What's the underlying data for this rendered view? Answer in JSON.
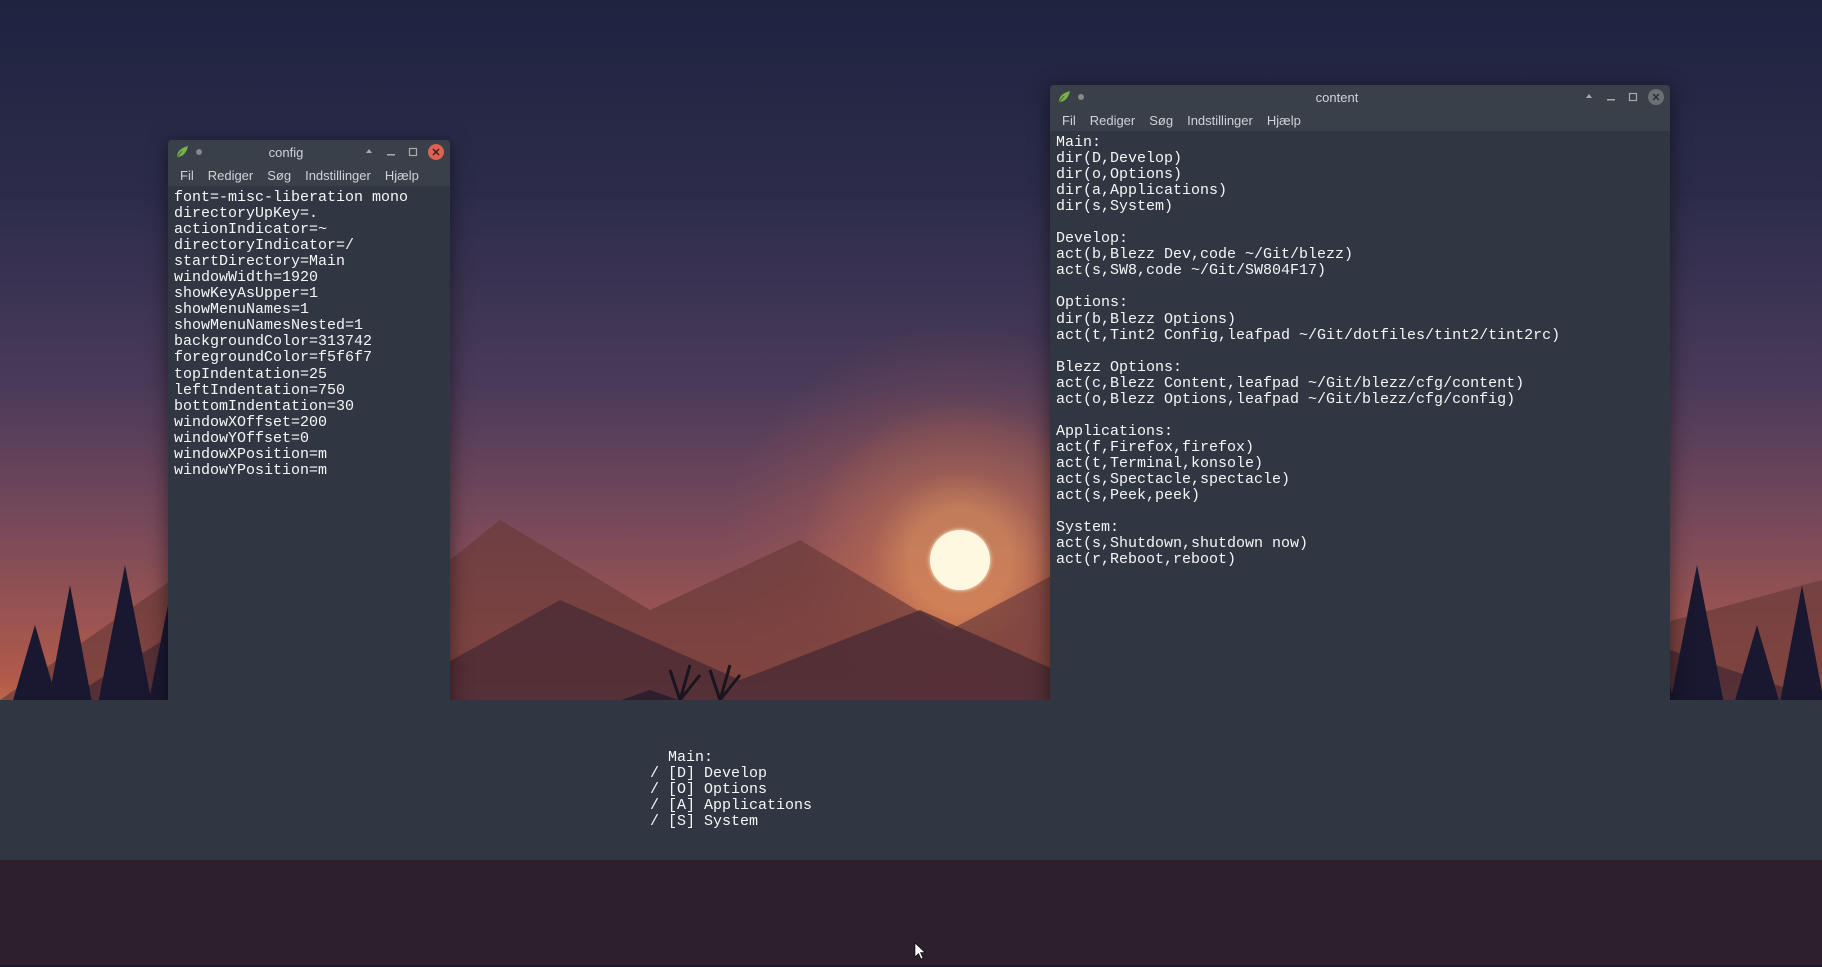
{
  "menubar": {
    "fil": "Fil",
    "rediger": "Rediger",
    "sog": "Søg",
    "indstillinger": "Indstillinger",
    "hjaelp": "Hjælp"
  },
  "window_config": {
    "title": "config",
    "content": "font=-misc-liberation mono\ndirectoryUpKey=.\nactionIndicator=~\ndirectoryIndicator=/\nstartDirectory=Main\nwindowWidth=1920\nshowKeyAsUpper=1\nshowMenuNames=1\nshowMenuNamesNested=1\nbackgroundColor=313742\nforegroundColor=f5f6f7\ntopIndentation=25\nleftIndentation=750\nbottomIndentation=30\nwindowXOffset=200\nwindowYOffset=0\nwindowXPosition=m\nwindowYPosition=m"
  },
  "window_content": {
    "title": "content",
    "content": "Main:\ndir(D,Develop)\ndir(o,Options)\ndir(a,Applications)\ndir(s,System)\n\nDevelop:\nact(b,Blezz Dev,code ~/Git/blezz)\nact(s,SW8,code ~/Git/SW804F17)\n\nOptions:\ndir(b,Blezz Options)\nact(t,Tint2 Config,leafpad ~/Git/dotfiles/tint2/tint2rc)\n\nBlezz Options:\nact(c,Blezz Content,leafpad ~/Git/blezz/cfg/content)\nact(o,Blezz Options,leafpad ~/Git/blezz/cfg/config)\n\nApplications:\nact(f,Firefox,firefox)\nact(t,Terminal,konsole)\nact(s,Spectacle,spectacle)\nact(s,Peek,peek)\n\nSystem:\nact(s,Shutdown,shutdown now)\nact(r,Reboot,reboot)"
  },
  "launcher": {
    "content": "Main:\n/ [D] Develop\n/ [O] Options\n/ [A] Applications\n/ [S] System"
  }
}
